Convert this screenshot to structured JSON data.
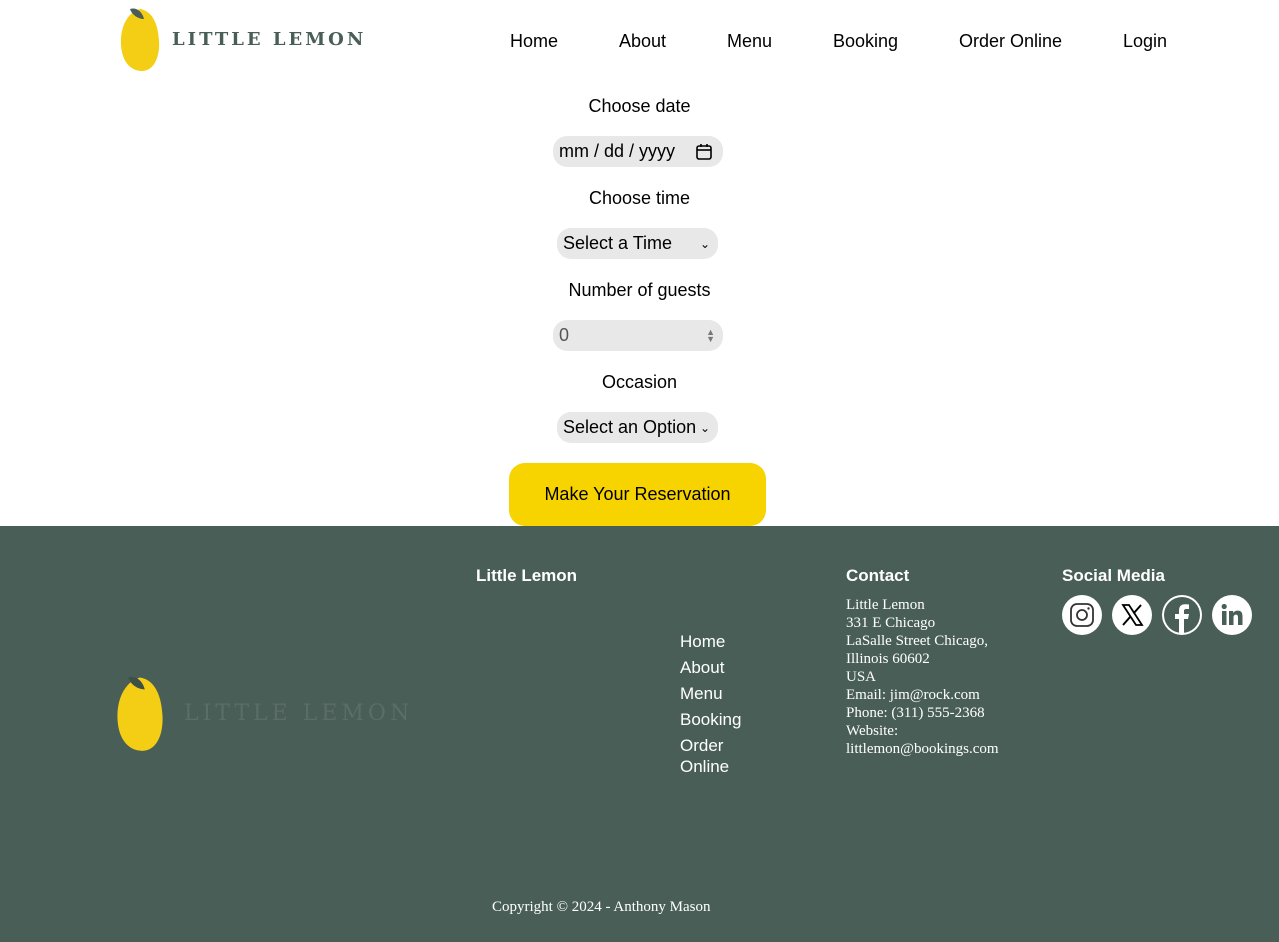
{
  "header": {
    "brand": "LITTLE LEMON",
    "nav": [
      "Home",
      "About",
      "Menu",
      "Booking",
      "Order Online",
      "Login"
    ]
  },
  "form": {
    "date_label": "Choose date",
    "date_placeholder": "mm / dd / yyyy",
    "time_label": "Choose time",
    "time_value": "Select a Time",
    "guests_label": "Number of guests",
    "guests_value": "0",
    "occasion_label": "Occasion",
    "occasion_value": "Select an Option",
    "submit_label": "Make Your Reservation"
  },
  "footer": {
    "brand": "LITTLE LEMON",
    "nav_heading": "Little Lemon",
    "nav": [
      "Home",
      "About",
      "Menu",
      "Booking",
      "Order Online"
    ],
    "contact_heading": "Contact",
    "contact_lines": [
      "Little Lemon",
      "331 E Chicago",
      "LaSalle Street Chicago, Illinois 60602",
      "USA",
      "Email: jim@rock.com",
      "Phone: (311) 555-2368",
      "Website: littlemon@bookings.com"
    ],
    "social_heading": "Social Media",
    "social_icons": [
      "instagram-icon",
      "x-icon",
      "facebook-icon",
      "linkedin-icon"
    ],
    "copyright": "Copyright © 2024 - Anthony Mason"
  },
  "colors": {
    "accent": "#f7d300",
    "footer_bg": "#495e57",
    "field_bg": "#e8e8e8"
  }
}
